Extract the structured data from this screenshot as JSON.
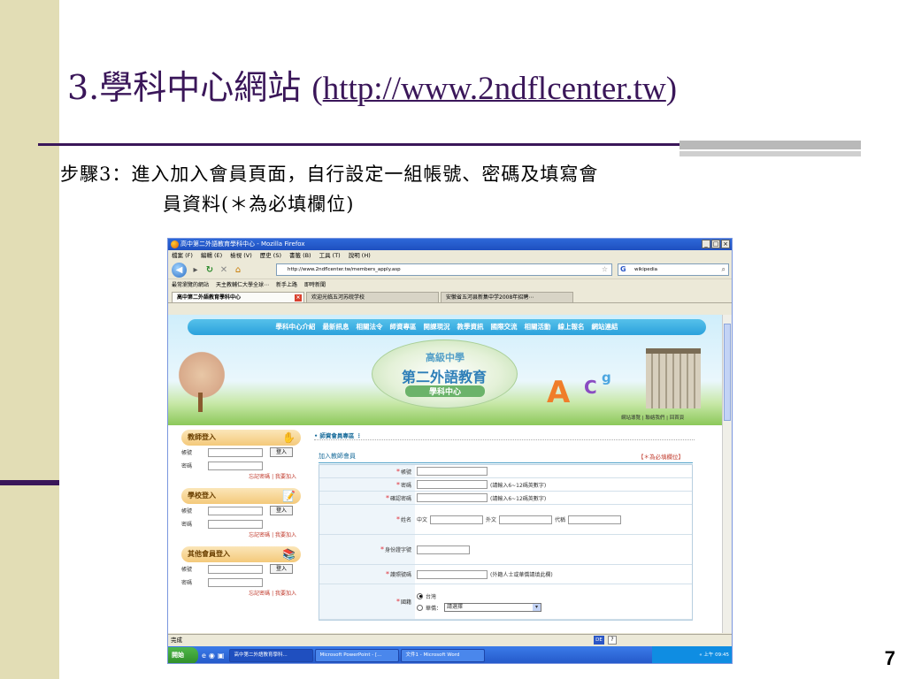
{
  "slide": {
    "title_prefix": "3.學科中心網站",
    "title_open": "(",
    "title_url": "http://www.2ndflcenter.tw",
    "title_close": ")",
    "step_line1": "步驟3：進入加入會員頁面，自行設定一組帳號、密碼及填寫會",
    "step_line2": "員資料(＊為必填欄位)",
    "page_number": "7"
  },
  "browser": {
    "window_title": "高中第二外語教育學科中心 - Mozilla Firefox",
    "window_buttons": [
      "_",
      "□",
      "×"
    ],
    "menu": [
      "檔案 (F)",
      "編輯 (E)",
      "檢視 (V)",
      "歷史 (S)",
      "書籤 (B)",
      "工具 (T)",
      "說明 (H)"
    ],
    "url": "http://www.2ndflcenter.tw/members_apply.asp",
    "search_value": "wikipedia",
    "bookmarks": [
      "最常瀏覽的網站",
      "天主教輔仁大學全球⋯",
      "新手上路",
      "即時新聞"
    ],
    "tabs": [
      {
        "label": "高中第二外語教育學科中心",
        "active": true
      },
      {
        "label": "欢迎光临五河苏皖学校",
        "active": false
      },
      {
        "label": "安徽省五河县新集中学2008年招聘⋯",
        "active": false
      }
    ],
    "status_text": "完成",
    "status_lang": "DE"
  },
  "site": {
    "nav": [
      "學科中心介紹",
      "最新訊息",
      "相關法令",
      "師資專區",
      "開課現況",
      "教學資訊",
      "國際交流",
      "相關活動",
      "線上報名",
      "網站連結"
    ],
    "hero_line1": "高級中學",
    "hero_line2": "第二外語教育",
    "hero_line3": "學科中心",
    "letter_a": "A",
    "letter_c": "C",
    "letter_g": "g",
    "header_links": "網站導覽 | 聯絡我們 | 回首頁",
    "login_boxes": [
      {
        "title": "教師登入",
        "icon": "✋"
      },
      {
        "title": "學校登入",
        "icon": "📝"
      },
      {
        "title": "其他會員登入",
        "icon": "📚"
      }
    ],
    "login_account": "帳號",
    "login_password": "密碼",
    "login_button": "登入",
    "login_links": "忘記密碼 | 我要加入",
    "crumb": "• 師資會員專區 ⋮",
    "form_title": "加入教師會員",
    "form_required_note": "【＊為必填欄位】",
    "fields": {
      "account": "帳號",
      "password": "密碼",
      "password_hint": "(請輸入6~12碼英數字)",
      "confirm": "確認密碼",
      "confirm_hint": "(請輸入6~12碼英數字)",
      "name": "姓名",
      "name_zh": "中文",
      "name_en": "外文",
      "name_alias": "代稱",
      "id_no": "身份證字號",
      "passport": "護照號碼",
      "passport_hint": "(外籍人士或華僑請填此欄)",
      "nationality": "國籍",
      "nat_tw": "台灣",
      "nat_overseas": "華僑：",
      "nat_select": "請選擇"
    }
  },
  "taskbar": {
    "start": "開始",
    "tasks": [
      "高中第二外語教育學科...",
      "Microsoft PowerPoint - [...",
      "文件1 - Microsoft Word"
    ],
    "clock": "«  上午 09:45"
  }
}
